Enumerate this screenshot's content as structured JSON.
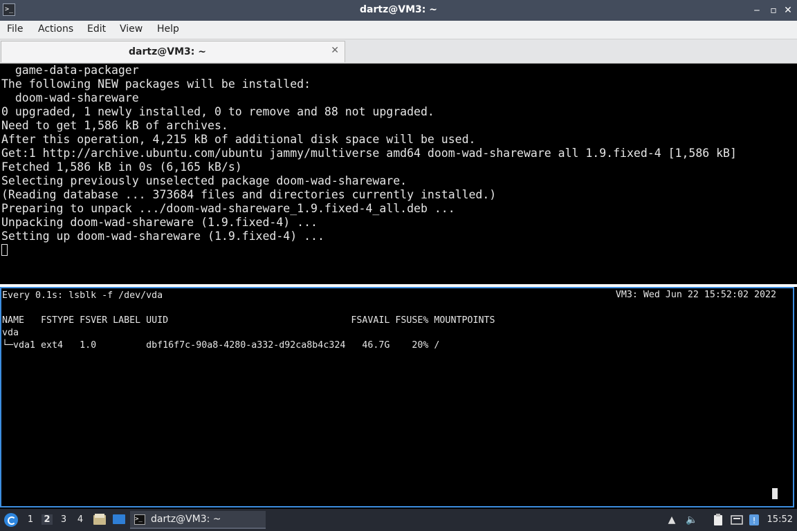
{
  "window": {
    "title": "dartz@VM3: ~",
    "minimize": "‒",
    "restore": "▫",
    "close": "✕"
  },
  "menu": [
    "File",
    "Actions",
    "Edit",
    "View",
    "Help"
  ],
  "tab": {
    "label": "dartz@VM3: ~",
    "close": "✕"
  },
  "terminal_top": {
    "lines": [
      "  game-data-packager",
      "The following NEW packages will be installed:",
      "  doom-wad-shareware",
      "0 upgraded, 1 newly installed, 0 to remove and 88 not upgraded.",
      "Need to get 1,586 kB of archives.",
      "After this operation, 4,215 kB of additional disk space will be used.",
      "Get:1 http://archive.ubuntu.com/ubuntu jammy/multiverse amd64 doom-wad-shareware all 1.9.fixed-4 [1,586 kB]",
      "Fetched 1,586 kB in 0s (6,165 kB/s)",
      "Selecting previously unselected package doom-wad-shareware.",
      "(Reading database ... 373684 files and directories currently installed.)",
      "Preparing to unpack .../doom-wad-shareware_1.9.fixed-4_all.deb ...",
      "Unpacking doom-wad-shareware (1.9.fixed-4) ...",
      "Setting up doom-wad-shareware (1.9.fixed-4) ..."
    ]
  },
  "terminal_bottom": {
    "watch_header": "Every 0.1s: lsblk -f /dev/vda",
    "watch_host_time": "VM3: Wed Jun 22 15:52:02 2022",
    "lsblk_header": "NAME   FSTYPE FSVER LABEL UUID                                 FSAVAIL FSUSE% MOUNTPOINTS",
    "row_disk": "vda",
    "row_part": "└─vda1 ext4   1.0         dbf16f7c-90a8-4280-a332-d92ca8b4c324   46.7G    20% /"
  },
  "taskbar": {
    "workspaces": [
      "1",
      "2",
      "3",
      "4"
    ],
    "active_workspace": "2",
    "task_label": "dartz@VM3: ~",
    "clock": "15:52"
  },
  "colors": {
    "titlebar": "#434c5c",
    "terminal_bg": "#000000",
    "terminal_fg": "#e6e6e6",
    "active_pane_border": "#3d8ee0",
    "taskbar": "#262a33"
  },
  "icons": {
    "app": "terminal-icon",
    "start": "lubuntu-start-icon",
    "file_manager": "file-manager-icon",
    "desktop": "show-desktop-icon",
    "tray": [
      "network-upload-icon",
      "volume-icon",
      "clipboard-icon",
      "keyboard-icon",
      "update-notifier-icon"
    ]
  }
}
